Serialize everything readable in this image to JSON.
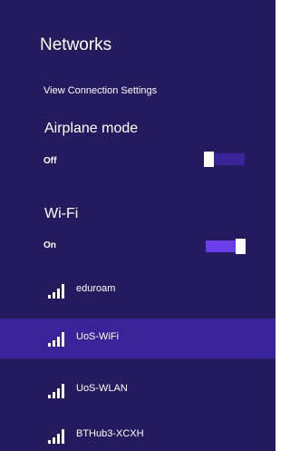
{
  "panel": {
    "title": "Networks",
    "connection_settings_link": "View Connection Settings"
  },
  "airplane_mode": {
    "label": "Airplane mode",
    "state": "Off",
    "on": false
  },
  "wifi": {
    "label": "Wi-Fi",
    "state": "On",
    "on": true
  },
  "networks": [
    {
      "name": "eduroam",
      "selected": false,
      "icon": "wifi-signal-icon"
    },
    {
      "name": "UoS-WiFi",
      "selected": true,
      "icon": "wifi-signal-icon"
    },
    {
      "name": "UoS-WLAN",
      "selected": false,
      "icon": "wifi-signal-icon"
    },
    {
      "name": "BTHub3-XCXH",
      "selected": false,
      "icon": "wifi-signal-icon"
    }
  ],
  "colors": {
    "panel_background": "#221c5e",
    "selected_row": "#3a2299",
    "toggle_on_track": "#6a3ee8",
    "toggle_off_track": "#3c2399"
  }
}
